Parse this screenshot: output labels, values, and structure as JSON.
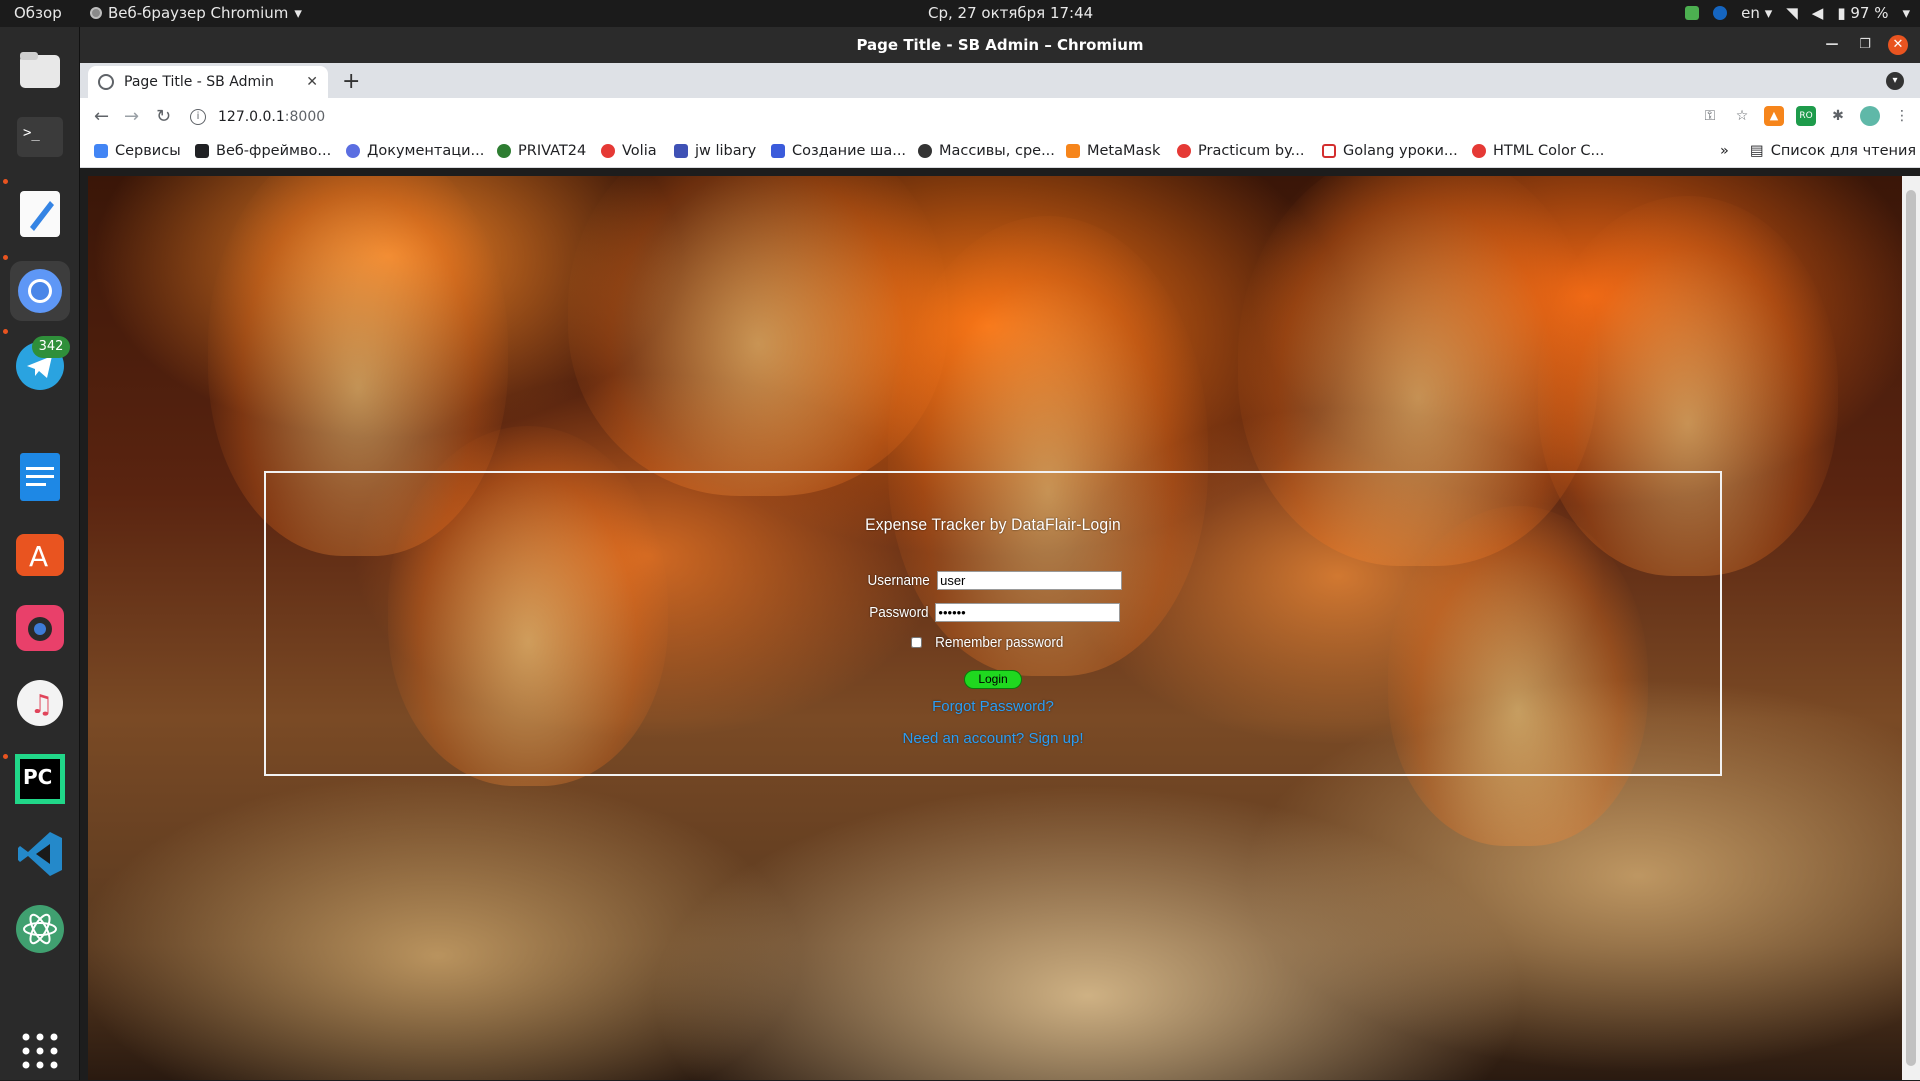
{
  "system_bar": {
    "overview": "Обзор",
    "app_menu": "Веб-браузер Chromium",
    "clock": "Ср, 27 октября  17:44",
    "lang": "en",
    "battery": "97 %"
  },
  "dock": {
    "telegram_badge": "342",
    "apps": [
      "files",
      "terminal",
      "text-editor",
      "chromium",
      "telegram",
      "libreoffice-writer",
      "app-center",
      "camera",
      "rhythmbox",
      "pycharm",
      "vscode",
      "atom",
      "show-apps"
    ]
  },
  "window": {
    "title": "Page Title - SB Admin – Chromium"
  },
  "tab": {
    "title": "Page Title - SB Admin",
    "close": "✕",
    "new_tab": "+"
  },
  "address_bar": {
    "host": "127.0.0.1",
    "port": ":8000"
  },
  "bookmarks": [
    {
      "label": "Сервисы",
      "color": "#4285f4"
    },
    {
      "label": "Веб-фреймво...",
      "color": "#202124"
    },
    {
      "label": "Документаци...",
      "color": "#5b6ee1"
    },
    {
      "label": "PRIVAT24",
      "color": "#2e7d32"
    },
    {
      "label": "Volia",
      "color": "#e53935"
    },
    {
      "label": "jw libary",
      "color": "#3f51b5"
    },
    {
      "label": "Создание ша...",
      "color": "#3b5bdb"
    },
    {
      "label": "Массивы, сре...",
      "color": "#333333"
    },
    {
      "label": "MetaMask",
      "color": "#f6851b"
    },
    {
      "label": "Practicum by...",
      "color": "#e53935"
    },
    {
      "label": "Golang уроки...",
      "color": "#d32f2f"
    },
    {
      "label": "HTML Color C...",
      "color": "#e53935"
    }
  ],
  "bookmarks_more": "»",
  "reading_list": "Список для чтения",
  "login": {
    "title": "Expense Tracker by DataFlair-Login",
    "username_label": "Username",
    "username_value": "user",
    "password_label": "Password",
    "password_value": "123456",
    "remember_label": "Remember password",
    "login_button": "Login",
    "forgot_link": "Forgot Password?",
    "signup_link": "Need an account? Sign up!"
  },
  "colors": {
    "login_button": "#1fd81f",
    "link": "#2a9df4",
    "ubuntu_accent": "#e95420"
  }
}
